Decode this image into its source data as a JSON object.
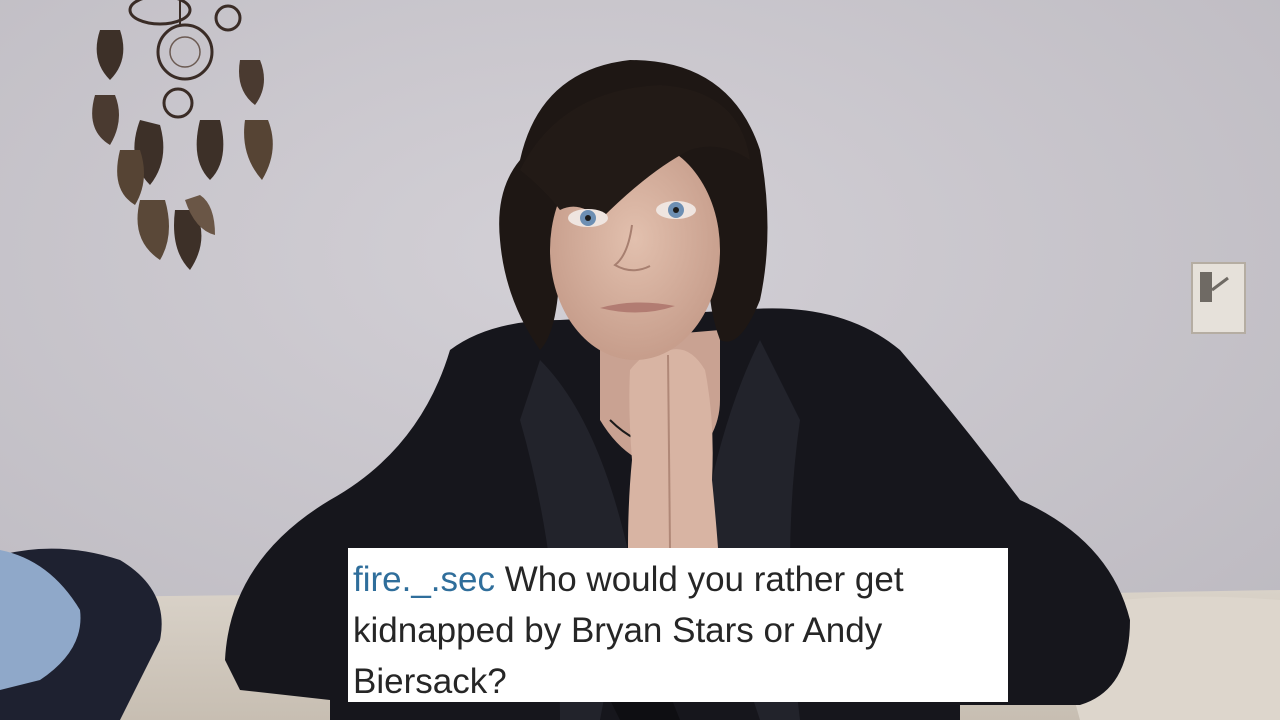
{
  "caption": {
    "username": "fire._.sec",
    "question": "Who would you rather get kidnapped by Bryan Stars or Andy Biersack?"
  },
  "colors": {
    "wall": "#c9c6cc",
    "jacket": "#16161c",
    "hair": "#1e1714",
    "skin": "#d8b4a3",
    "eyes": "#6d8fb3",
    "caption_bg": "#ffffff",
    "username": "#2f6e9b",
    "caption_text": "#262626"
  }
}
